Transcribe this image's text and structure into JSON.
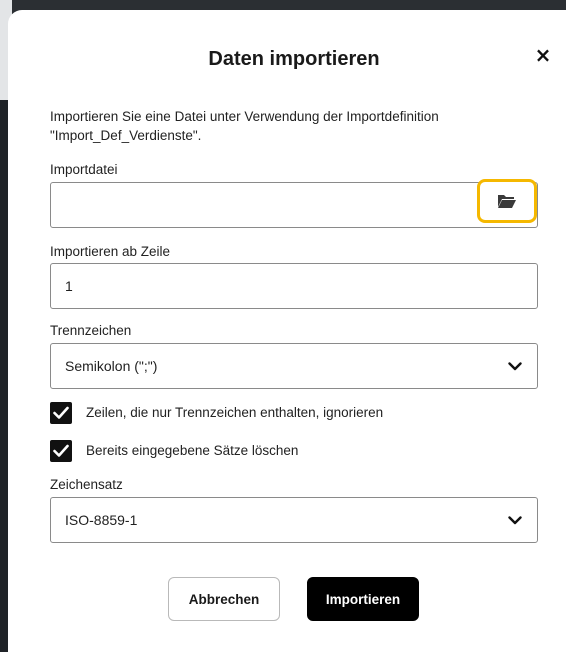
{
  "dialog": {
    "title": "Daten importieren",
    "close_label": "×",
    "description": "Importieren Sie eine Datei unter Verwendung der Importdefinition \"Import_Def_Verdienste\"."
  },
  "import_file": {
    "label": "Importdatei",
    "value": "",
    "browse_icon": "folder-open-icon"
  },
  "start_row": {
    "label": "Importieren ab Zeile",
    "value": "1"
  },
  "separator": {
    "label": "Trennzeichen",
    "selected": "Semikolon (\";\")"
  },
  "options": [
    {
      "label": "Zeilen, die nur Trennzeichen enthalten, ignorieren",
      "checked": true
    },
    {
      "label": "Bereits eingegebene Sätze löschen",
      "checked": true
    }
  ],
  "charset": {
    "label": "Zeichensatz",
    "selected": "ISO-8859-1"
  },
  "buttons": {
    "cancel": "Abbrechen",
    "import": "Importieren"
  },
  "colors": {
    "highlight": "#f5b800",
    "primary_button": "#000000"
  }
}
